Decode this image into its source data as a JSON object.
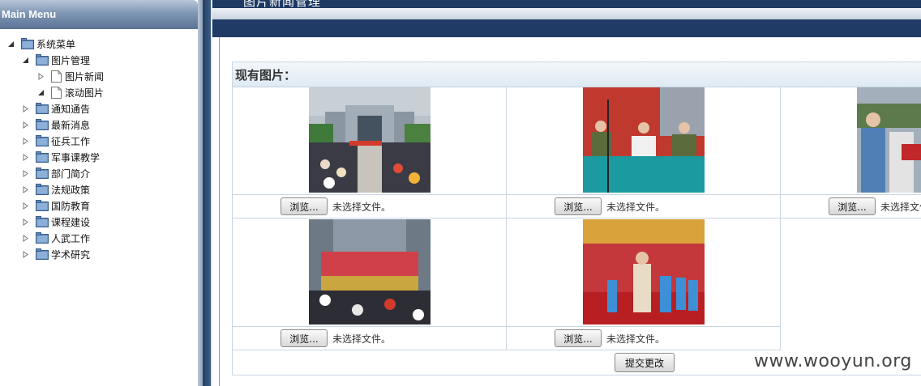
{
  "sidebar": {
    "title": "Main Menu",
    "root": "系统菜单",
    "group": "图片管理",
    "group_children": [
      "图片新闻",
      "滚动图片"
    ],
    "items": [
      "通知通告",
      "最新消息",
      "征兵工作",
      "军事课教学",
      "部门简介",
      "法规政策",
      "国防教育",
      "课程建设",
      "人武工作",
      "学术研究"
    ]
  },
  "header": {
    "title": "图片新闻管理"
  },
  "panel": {
    "title": "现有图片：",
    "browse_label": "浏览...",
    "no_file_label": "未选择文件。",
    "submit_label": "提交更改"
  },
  "watermark": "www.wooyun.org",
  "colors": {
    "nav_dark": "#1e3a63",
    "panel_header": "#dfeaf3",
    "border": "#c9d6e3"
  }
}
